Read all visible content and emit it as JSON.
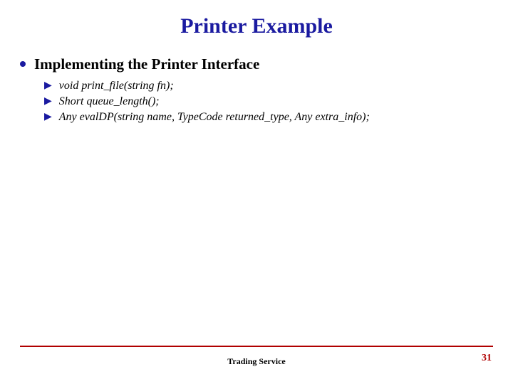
{
  "title": "Printer Example",
  "heading": "Implementing the Printer Interface",
  "items": [
    "void print_file(string fn);",
    "Short queue_length();",
    "Any evalDP(string name, TypeCode returned_type, Any extra_info);"
  ],
  "footer": "Trading Service",
  "page": "31"
}
